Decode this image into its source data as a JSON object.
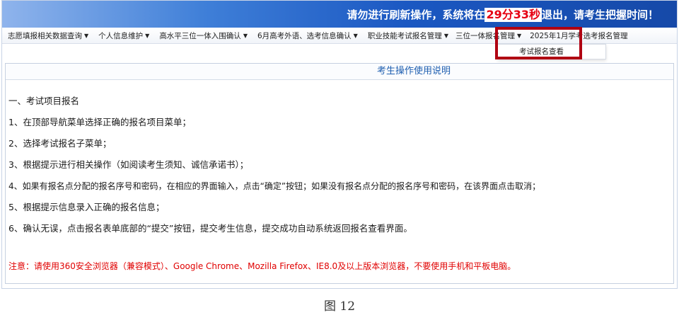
{
  "banner": {
    "msg_before": "请勿进行刷新操作，系统将在",
    "countdown": "29分33秒",
    "msg_after": "退出，请考生把握时间！"
  },
  "nav": {
    "items": [
      {
        "label": "志愿填报相关数据查询"
      },
      {
        "label": "个人信息维护"
      },
      {
        "label": "高水平三位一体入围确认"
      },
      {
        "label": "6月高考外语、选考信息确认"
      },
      {
        "label": "职业技能考试报名管理"
      },
      {
        "label": "三位一体报名管理"
      },
      {
        "label": "2025年1月学考选考报名管理"
      }
    ],
    "dropdown_item": "考试报名查看"
  },
  "section": {
    "title": "考生操作使用说明",
    "lines": [
      "一、考试项目报名",
      "1、在顶部导航菜单选择正确的报名项目菜单；",
      "2、选择考试报名子菜单；",
      "3、根据提示进行相关操作（如阅读考生须知、诚信承诺书）；",
      "4、如果有报名点分配的报名序号和密码，在相应的界面输入，点击“确定”按钮；如果没有报名点分配的报名序号和密码，在该界面点击取消；",
      "5、根据提示信息录入正确的报名信息；",
      "6、确认无误，点击报名表单底部的“提交”按钮，提交考生信息，提交成功自动系统返回报名查看界面。"
    ],
    "notice": "注意：请使用360安全浏览器（兼容模式）、Google Chrome、Mozilla Firefox、IE8.0及以上版本浏览器，不要使用手机和平板电脑。"
  },
  "caption": "图 12",
  "colors": {
    "banner_blue": "#1b58c2",
    "countdown_red": "#e60012",
    "highlight_red": "#b00012",
    "title_blue": "#1f5fb0",
    "notice_red": "#e00000"
  },
  "icons": {
    "nav_caret": "caret-down-icon"
  }
}
